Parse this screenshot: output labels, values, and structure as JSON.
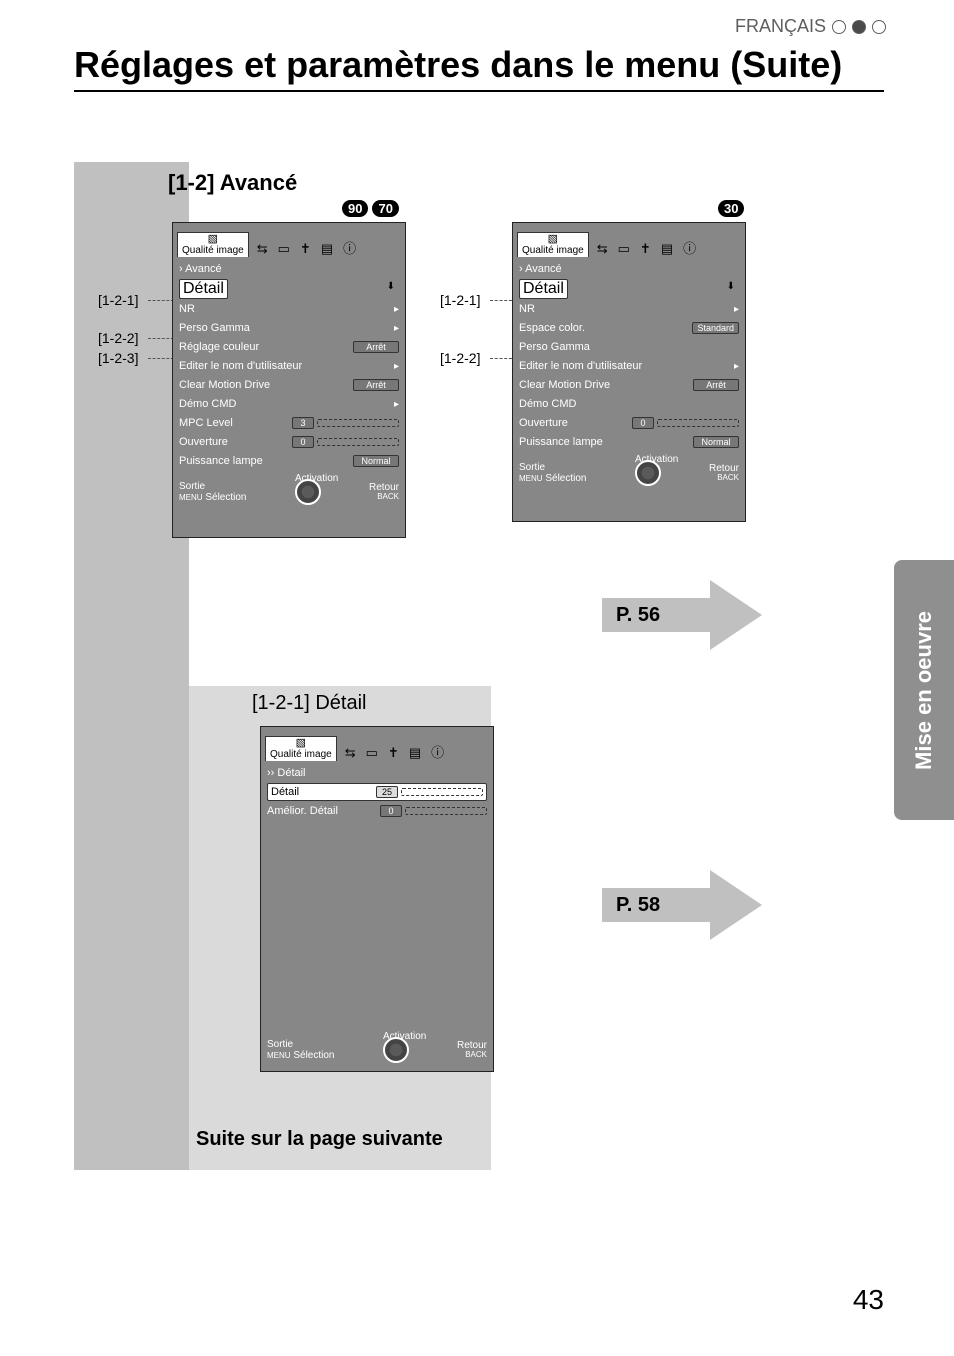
{
  "header": {
    "language": "FRANÇAIS",
    "title": "Réglages et paramètres dans le menu (Suite)"
  },
  "sidetab": "Mise en oeuvre",
  "section_title": "[1-2] Avancé",
  "sub_section_title": "[1-2-1] Détail",
  "continue_text": "Suite sur la page suivante",
  "page_number": "43",
  "arrows": {
    "p56": "P. 56",
    "p58": "P. 58"
  },
  "badges": {
    "left": [
      "90",
      "70"
    ],
    "right": [
      "30"
    ]
  },
  "callouts_left": {
    "a": "[1-2-1]",
    "b": "[1-2-2]",
    "c": "[1-2-3]"
  },
  "callouts_right": {
    "a": "[1-2-1]",
    "b": "[1-2-2]"
  },
  "osd_common": {
    "tab_label": "Qualité image",
    "crumb1": "› Avancé",
    "crumb2": "›› Détail",
    "footer": {
      "sortie": "Sortie",
      "menu": "MENU",
      "selection": "Sélection",
      "activation": "Activation",
      "retour": "Retour",
      "back": "BACK"
    }
  },
  "osd_left": {
    "highlight": "Détail",
    "rows": [
      {
        "label": "NR",
        "type": "arrow"
      },
      {
        "label": "Perso Gamma",
        "type": "arrow"
      },
      {
        "label": "Réglage couleur",
        "type": "value",
        "value": "Arrêt"
      },
      {
        "label": "Editer le nom d'utilisateur",
        "type": "arrow"
      },
      {
        "label": "Clear Motion Drive",
        "type": "value",
        "value": "Arrêt"
      },
      {
        "label": "Démo CMD",
        "type": "arrow"
      },
      {
        "label": "MPC Level",
        "type": "slider",
        "num": "3"
      },
      {
        "label": "Ouverture",
        "type": "slider",
        "num": "0"
      },
      {
        "label": "Puissance lampe",
        "type": "value",
        "value": "Normal"
      }
    ]
  },
  "osd_right": {
    "highlight": "Détail",
    "rows": [
      {
        "label": "NR",
        "type": "arrow"
      },
      {
        "label": "Espace color.",
        "type": "value",
        "value": "Standard"
      },
      {
        "label": "Perso Gamma",
        "type": "plain"
      },
      {
        "label": "Editer le nom d'utilisateur",
        "type": "arrow"
      },
      {
        "label": "Clear Motion Drive",
        "type": "value",
        "value": "Arrêt"
      },
      {
        "label": "Démo CMD",
        "type": "plain"
      },
      {
        "label": "Ouverture",
        "type": "slider",
        "num": "0"
      },
      {
        "label": "Puissance lampe",
        "type": "value",
        "value": "Normal"
      }
    ]
  },
  "osd_sub": {
    "rows": [
      {
        "label": "Détail",
        "type": "slider",
        "num": "25",
        "inv": true
      },
      {
        "label": "Amélior. Détail",
        "type": "slider",
        "num": "0"
      }
    ]
  }
}
